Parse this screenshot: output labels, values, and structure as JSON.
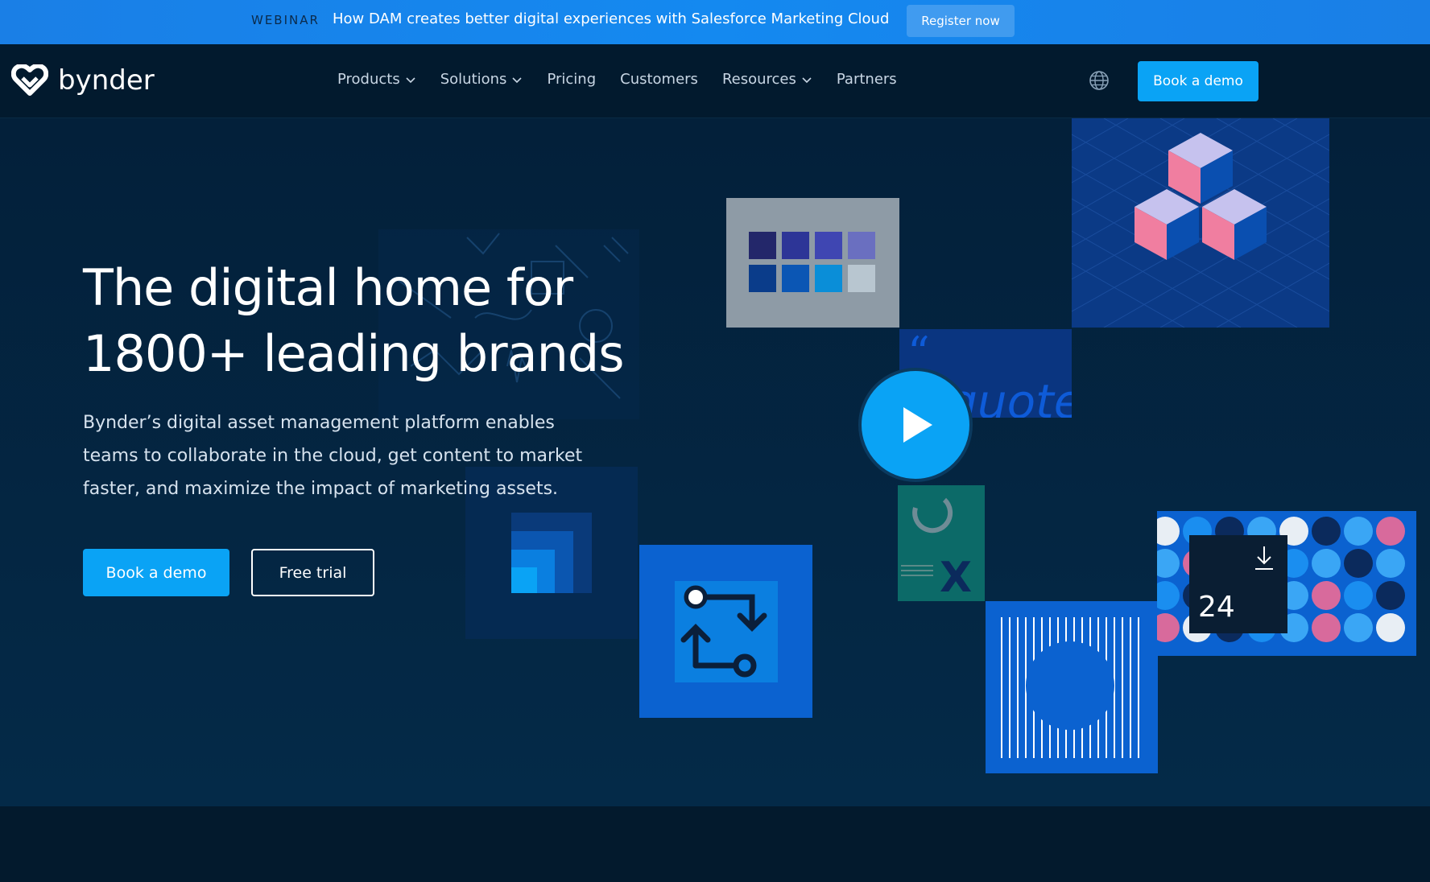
{
  "banner": {
    "tag": "WEBINAR",
    "text": "How DAM creates better digital experiences with Salesforce Marketing Cloud",
    "button_label": "Register now"
  },
  "nav": {
    "logo_text": "bynder",
    "items": [
      {
        "label": "Products",
        "dropdown": true
      },
      {
        "label": "Solutions",
        "dropdown": true
      },
      {
        "label": "Pricing",
        "dropdown": false
      },
      {
        "label": "Customers",
        "dropdown": false
      },
      {
        "label": "Resources",
        "dropdown": true
      },
      {
        "label": "Partners",
        "dropdown": false
      }
    ],
    "language_icon": "globe-icon",
    "book_demo_label": "Book a demo"
  },
  "hero": {
    "title_line1": "The digital home for",
    "title_line2": "1800+ leading brands",
    "description": "Bynder’s digital asset management platform enables teams to collaborate in the cloud, get content to market faster, and maximize the impact of marketing assets.",
    "primary_cta": "Book a demo",
    "secondary_cta": "Free trial"
  },
  "collage": {
    "calendar_number": "24",
    "play_icon": "play-icon",
    "quote_fragment": "quote",
    "excel_letter": "X"
  },
  "colors": {
    "accent": "#0aa3f5",
    "banner": "#1489f0",
    "background": "#021a2e"
  }
}
